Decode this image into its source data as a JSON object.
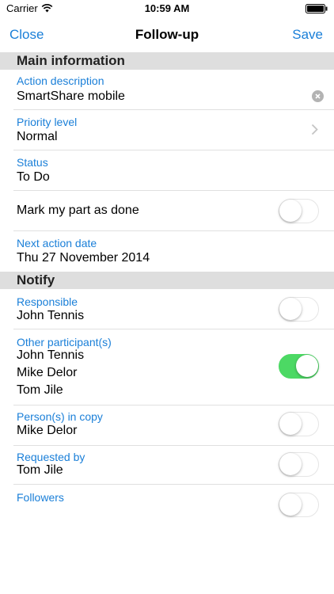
{
  "status_bar": {
    "carrier": "Carrier",
    "time": "10:59 AM"
  },
  "nav": {
    "close_label": "Close",
    "title": "Follow-up",
    "save_label": "Save"
  },
  "main_section": {
    "header": "Main information",
    "action_description": {
      "label": "Action description",
      "value": "SmartShare mobile"
    },
    "priority": {
      "label": "Priority level",
      "value": "Normal"
    },
    "status": {
      "label": "Status",
      "value": "To Do"
    },
    "mark_done": {
      "label": "Mark my part as done",
      "on": false
    },
    "next_action_date": {
      "label": "Next action date",
      "value": "Thu 27 November 2014"
    }
  },
  "notify_section": {
    "header": "Notify",
    "responsible": {
      "label": "Responsible",
      "names": [
        "John Tennis"
      ],
      "on": false
    },
    "other_participants": {
      "label": "Other participant(s)",
      "names": [
        "John Tennis",
        "Mike Delor",
        "Tom Jile"
      ],
      "on": true
    },
    "persons_in_copy": {
      "label": "Person(s) in copy",
      "names": [
        "Mike Delor"
      ],
      "on": false
    },
    "requested_by": {
      "label": "Requested by",
      "names": [
        "Tom Jile"
      ],
      "on": false
    },
    "followers": {
      "label": "Followers",
      "names": [],
      "on": false
    }
  },
  "colors": {
    "accent": "#1a7fd8",
    "toggle_on": "#4cd964",
    "section_bg": "#dedede"
  }
}
